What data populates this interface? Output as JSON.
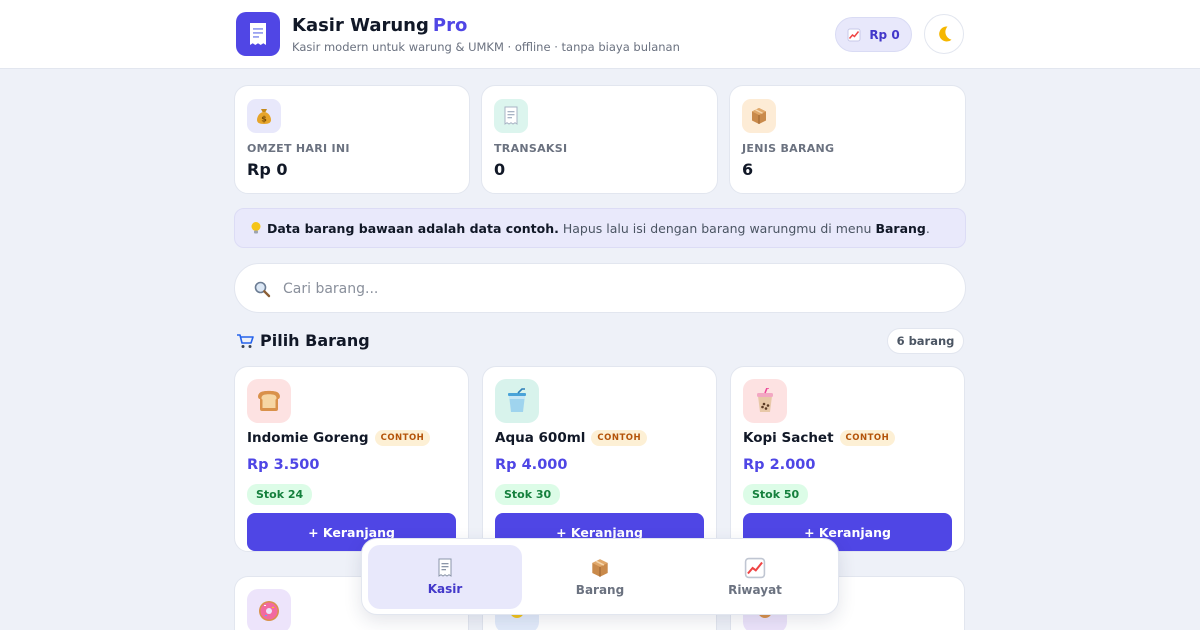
{
  "header": {
    "title": "Kasir Warung",
    "title_accent": "Pro",
    "subtitle": "Kasir modern untuk warung & UMKM · offline · tanpa biaya bulanan",
    "revenue_badge": "Rp 0",
    "logo_icon": "receipt-icon",
    "theme_icon": "moon-icon"
  },
  "stats": [
    {
      "label": "OMZET HARI INI",
      "value": "Rp 0",
      "icon": "money-bag-icon"
    },
    {
      "label": "TRANSAKSI",
      "value": "0",
      "icon": "receipt-icon"
    },
    {
      "label": "JENIS BARANG",
      "value": "6",
      "icon": "package-icon"
    }
  ],
  "banner": {
    "icon": "lightbulb-icon",
    "bold": "Data barang bawaan adalah data contoh.",
    "text": "Hapus lalu isi dengan barang warungmu di menu",
    "bold_menu": "Barang",
    "end": "."
  },
  "search": {
    "placeholder": "Cari barang...",
    "value": ""
  },
  "products_section": {
    "title": "Pilih Barang",
    "icon": "cart-icon",
    "count": "6 barang"
  },
  "products": [
    {
      "name": "Indomie Goreng",
      "badge": "CONTOH",
      "price": "Rp 3.500",
      "stock": "Stok 24",
      "button": "+ Keranjang",
      "icon": "bread-icon"
    },
    {
      "name": "Aqua 600ml",
      "badge": "CONTOH",
      "price": "Rp 4.000",
      "stock": "Stok 30",
      "button": "+ Keranjang",
      "icon": "cup-straw-icon"
    },
    {
      "name": "Kopi Sachet",
      "badge": "CONTOH",
      "price": "Rp 2.000",
      "stock": "Stok 50",
      "button": "+ Keranjang",
      "icon": "bubble-tea-icon"
    }
  ],
  "bottom_nav": [
    {
      "label": "Kasir",
      "icon": "receipt-icon",
      "active": true
    },
    {
      "label": "Barang",
      "icon": "package-icon",
      "active": false
    },
    {
      "label": "Riwayat",
      "icon": "chart-up-icon",
      "active": false
    }
  ],
  "colors": {
    "accent": "#5046e5",
    "background": "#eef1f8",
    "badge_sample": "#fdf0d5",
    "stock_green": "#15803d"
  }
}
